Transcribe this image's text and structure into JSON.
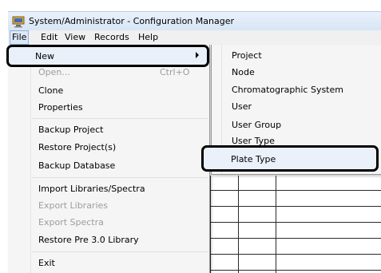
{
  "window": {
    "title": "System/Administrator - Configuration Manager",
    "icon": "app-computer-icon"
  },
  "menubar": {
    "items": [
      "File",
      "Edit",
      "View",
      "Records",
      "Help"
    ],
    "active": "File"
  },
  "file_menu": {
    "new_label": "New",
    "open_label": "Open...",
    "open_shortcut": "Ctrl+O",
    "clone_label": "Clone",
    "properties_label": "Properties",
    "backup_project_label": "Backup Project",
    "restore_project_label": "Restore Project(s)",
    "backup_database_label": "Backup Database",
    "import_libraries_label": "Import Libraries/Spectra",
    "export_libraries_label": "Export Libraries",
    "export_spectra_label": "Export Spectra",
    "restore_pre30_label": "Restore Pre 3.0 Library",
    "exit_label": "Exit"
  },
  "new_submenu": {
    "items": [
      "Project",
      "Node",
      "Chromatographic System",
      "User",
      "User Group",
      "User Type"
    ],
    "plate_type_label": "Plate Type"
  }
}
